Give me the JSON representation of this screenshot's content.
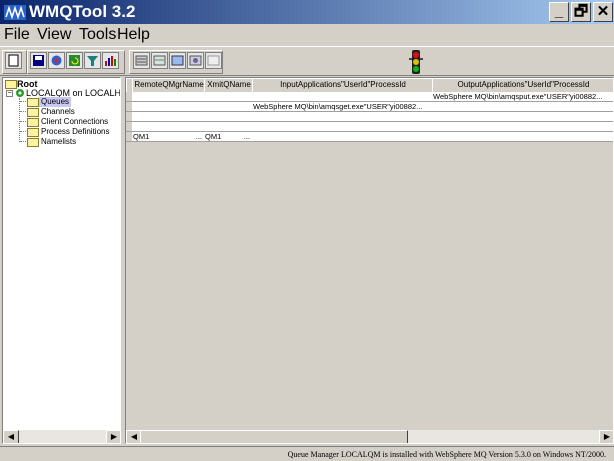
{
  "window": {
    "title": "WMQTool 3.2",
    "minimize": "_",
    "restore": "🗗",
    "close": "✕"
  },
  "menu": [
    "File",
    "View",
    "Tools",
    "Help"
  ],
  "toolbar": {
    "icons": [
      "panel-icon",
      "save-icon",
      "connect-icon",
      "refresh-icon",
      "filter-icon",
      "chart-icon",
      "queue-list-icon",
      "channel-list-icon",
      "put-message-icon",
      "browse-icon",
      "blank-icon"
    ],
    "status_light": "traffic-light-icon"
  },
  "tree": {
    "root": "Root",
    "qm": "LOCALQM on LOCALHC",
    "children": [
      "Queues",
      "Channels",
      "Client Connections",
      "Process Definitions",
      "Namelists"
    ],
    "selected": "Queues"
  },
  "grid": {
    "columns": [
      "RemoteQMgrName",
      "XmitQName",
      "InputApplications\"UserId\"ProcessId",
      "OutputApplications\"UserId\"ProcessId"
    ],
    "rows": [
      [
        "",
        "",
        "",
        "WebSphere MQ\\bin\\amqsput.exe\"USER\"yi00882..."
      ],
      [
        "",
        "",
        "WebSphere MQ\\bin\\amqsget.exe\"USER\"yi00882...",
        ""
      ],
      [
        "",
        "",
        "",
        ""
      ],
      [
        "",
        "",
        "",
        ""
      ],
      [
        "QM1",
        "QM1",
        "",
        ""
      ]
    ],
    "row_suffix": "..."
  },
  "status": "Queue Manager LOCALQM is installed with WebSphere MQ Version 5.3.0 on Windows NT/2000.",
  "colors": {
    "title_start": "#0a246a",
    "title_end": "#a6caf0",
    "selection": "#c8c8f4",
    "face": "#d4d0c8"
  }
}
